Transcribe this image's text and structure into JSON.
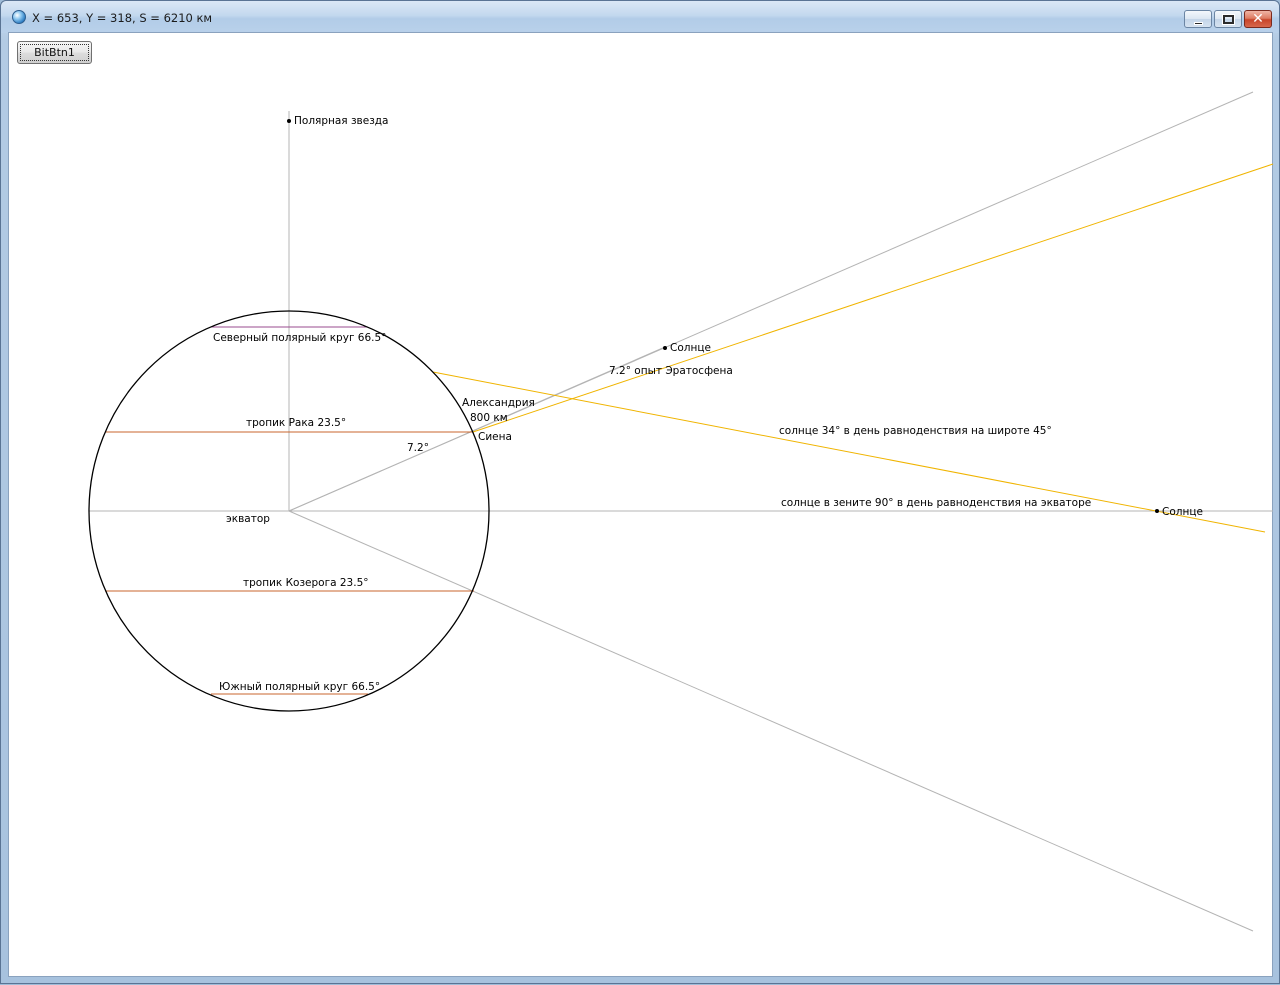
{
  "window": {
    "title": "X = 653, Y = 318, S = 6210 км",
    "icon": "globe-icon",
    "controls": {
      "minimize": "minimize-icon",
      "maximize": "restore-icon",
      "close": "close-icon",
      "close_glyph": "✕"
    }
  },
  "toolbar": {
    "button_label": "BitBtn1"
  },
  "diagram": {
    "colors": {
      "guide": "#b4b4b4",
      "sun_ray": "#f0b400",
      "tropic": "#c8642d",
      "arctic": "#9a4b8f",
      "globe": "#000000"
    },
    "labels": {
      "polaris": "Полярная звезда",
      "arctic_circle": "Северный полярный круг 66.5°",
      "tropic_cancer": "тропик Рака 23.5°",
      "equator": "экватор",
      "tropic_capricorn": "тропик Козерога 23.5°",
      "antarctic_circle": "Южный полярный круг  66.5°",
      "alexandria": "Александрия",
      "distance": "800 км",
      "syene": "Сиена",
      "angle_center": "7.2°",
      "sun_near": "Солнце",
      "eratosthenes": "7.2° опыт Эратосфена",
      "sun_34": "солнце 34° в день равноденствия на широте 45°",
      "sun_zenith": "солнце в зените 90° в день равноденствия на экваторе",
      "sun_far": "Солнце"
    }
  }
}
